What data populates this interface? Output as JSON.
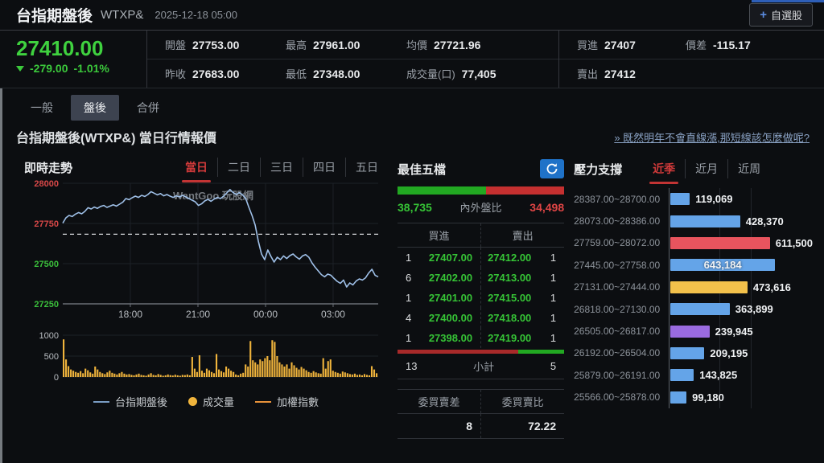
{
  "header": {
    "title": "台指期盤後",
    "symbol": "WTXP&",
    "datetime": "2025-12-18 05:00",
    "plus_icon": "+",
    "watchlist_label": "自選股"
  },
  "quote": {
    "price": "27410.00",
    "change": "-279.00",
    "change_pct": "-1.01%",
    "open_label": "開盤",
    "open": "27753.00",
    "high_label": "最高",
    "high": "27961.00",
    "avg_label": "均價",
    "avg": "27721.96",
    "prev_label": "昨收",
    "prev": "27683.00",
    "low_label": "最低",
    "low": "27348.00",
    "vol_label": "成交量(口)",
    "vol": "77,405",
    "bid_label": "買進",
    "bid": "27407",
    "spread_label": "價差",
    "spread": "-115.17",
    "ask_label": "賣出",
    "ask": "27412"
  },
  "tabs": {
    "general": "一般",
    "afterhours": "盤後",
    "combined": "合併"
  },
  "section": {
    "title": "台指期盤後(WTXP&) 當日行情報價",
    "promo_link": "» 既然明年不會直線漲,那短線該怎麼做呢?"
  },
  "chart": {
    "title": "即時走勢",
    "periods": [
      "當日",
      "二日",
      "三日",
      "四日",
      "五日"
    ],
    "active_period": "當日",
    "watermark": "WantGoo 玩股網",
    "legend": [
      {
        "label": "台指期盤後",
        "marker": "blue-line"
      },
      {
        "label": "成交量",
        "marker": "yellow-dot"
      },
      {
        "label": "加權指數",
        "marker": "orange-line"
      }
    ]
  },
  "chart_data": {
    "type": "line",
    "title": "即時走勢 當日",
    "x_ticks": [
      "18:00",
      "21:00",
      "00:00",
      "03:00"
    ],
    "x_tick_fracs": [
      0.2143,
      0.4286,
      0.6429,
      0.8571
    ],
    "y_ticks": [
      28000,
      27750,
      27500,
      27250
    ],
    "ylim": [
      27250,
      28000
    ],
    "prev_close": 27683,
    "price_values": [
      27752,
      27785,
      27800,
      27793,
      27808,
      27818,
      27810,
      27825,
      27848,
      27840,
      27852,
      27844,
      27856,
      27862,
      27850,
      27858,
      27866,
      27858,
      27870,
      27882,
      27905,
      27898,
      27910,
      27920,
      27912,
      27925,
      27918,
      27930,
      27948,
      27938,
      27928,
      27936,
      27922,
      27930,
      27920,
      27912,
      27922,
      27915,
      27925,
      27915,
      27905,
      27895,
      27885,
      27862,
      27872,
      27890,
      27900,
      27888,
      27902,
      27912,
      27905,
      27920,
      27940,
      27961,
      27942,
      27930,
      27942,
      27928,
      27905,
      27850,
      27800,
      27740,
      27640,
      27560,
      27525,
      27585,
      27545,
      27510,
      27540,
      27525,
      27548,
      27532,
      27550,
      27560,
      27542,
      27528,
      27548,
      27556,
      27540,
      27505,
      27478,
      27455,
      27432,
      27418,
      27435,
      27428,
      27408,
      27390,
      27378,
      27398,
      27355,
      27380,
      27368,
      27392,
      27405,
      27398,
      27412,
      27442,
      27465,
      27428,
      27418
    ],
    "volume_y_ticks": [
      1000,
      500,
      0
    ],
    "volume_values": [
      900,
      420,
      260,
      180,
      150,
      120,
      100,
      140,
      90,
      200,
      160,
      110,
      80,
      250,
      180,
      120,
      90,
      70,
      110,
      150,
      100,
      80,
      60,
      90,
      120,
      80,
      60,
      70,
      50,
      40,
      60,
      80,
      50,
      40,
      30,
      60,
      90,
      50,
      40,
      70,
      50,
      30,
      40,
      60,
      45,
      35,
      55,
      40,
      30,
      50,
      45,
      60,
      40,
      480,
      200,
      120,
      520,
      150,
      100,
      200,
      160,
      120,
      90,
      550,
      180,
      140,
      110,
      250,
      200,
      150,
      120,
      60,
      40,
      80,
      100,
      300,
      250,
      860,
      400,
      350,
      300,
      420,
      380,
      450,
      500,
      400,
      880,
      840,
      500,
      350,
      300,
      250,
      300,
      200,
      350,
      280,
      220,
      180,
      240,
      200,
      160,
      120,
      100,
      140,
      110,
      90,
      80,
      450,
      200,
      380,
      420,
      150,
      120,
      100,
      80,
      130,
      110,
      90,
      70,
      60,
      80,
      50,
      60,
      40,
      70,
      50,
      40,
      260,
      180,
      90
    ]
  },
  "best_five": {
    "title": "最佳五檔",
    "inner": "38,735",
    "ratio_label": "內外盤比",
    "outer": "34,498",
    "inner_pct": 52.9,
    "buy_header": "買進",
    "sell_header": "賣出",
    "rows": [
      {
        "bq": "1",
        "bp": "27407.00",
        "sp": "27412.00",
        "sq": "1"
      },
      {
        "bq": "6",
        "bp": "27402.00",
        "sp": "27413.00",
        "sq": "1"
      },
      {
        "bq": "1",
        "bp": "27401.00",
        "sp": "27415.00",
        "sq": "1"
      },
      {
        "bq": "4",
        "bp": "27400.00",
        "sp": "27418.00",
        "sq": "1"
      },
      {
        "bq": "1",
        "bp": "27398.00",
        "sp": "27419.00",
        "sq": "1"
      }
    ],
    "buy_total": "13",
    "subtotal_label": "小計",
    "sell_total": "5",
    "buy_total_pct": 72.2,
    "order_diff_label": "委買賣差",
    "order_diff": "8",
    "order_ratio_label": "委買賣比",
    "order_ratio": "72.22"
  },
  "pressure": {
    "title": "壓力支撐",
    "tabs": [
      "近季",
      "近月",
      "近周"
    ],
    "active_tab": "近季",
    "max_value": 643184,
    "colors": {
      "blue": "#64a4e8",
      "red": "#e8545e",
      "yellow": "#f3c14b",
      "purple": "#9a6be0"
    },
    "rows": [
      {
        "range": "28387.00~28700.00",
        "value": "119,069",
        "num": 119069,
        "color": "blue"
      },
      {
        "range": "28073.00~28386.00",
        "value": "428,370",
        "num": 428370,
        "color": "blue"
      },
      {
        "range": "27759.00~28072.00",
        "value": "611,500",
        "num": 611500,
        "color": "red"
      },
      {
        "range": "27445.00~27758.00",
        "value": "643,184",
        "num": 643184,
        "color": "blue",
        "label_inside": true
      },
      {
        "range": "27131.00~27444.00",
        "value": "473,616",
        "num": 473616,
        "color": "yellow"
      },
      {
        "range": "26818.00~27130.00",
        "value": "363,899",
        "num": 363899,
        "color": "blue"
      },
      {
        "range": "26505.00~26817.00",
        "value": "239,945",
        "num": 239945,
        "color": "purple"
      },
      {
        "range": "26192.00~26504.00",
        "value": "209,195",
        "num": 209195,
        "color": "blue"
      },
      {
        "range": "25879.00~26191.00",
        "value": "143,825",
        "num": 143825,
        "color": "blue"
      },
      {
        "range": "25566.00~25878.00",
        "value": "99,180",
        "num": 99180,
        "color": "blue"
      }
    ]
  }
}
